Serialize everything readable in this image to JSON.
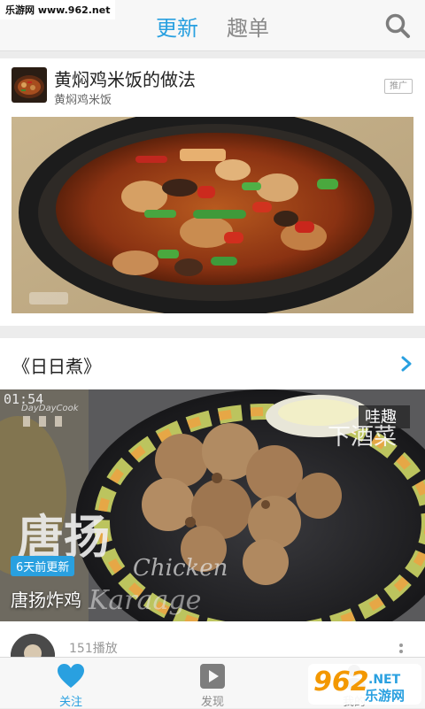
{
  "watermark": "乐游网 www.962.net",
  "header": {
    "tabs": [
      {
        "label": "更新",
        "active": true
      },
      {
        "label": "趣单",
        "active": false
      }
    ]
  },
  "ad_card": {
    "title": "黄焖鸡米饭的做法",
    "subtitle": "黄焖鸡米饭",
    "badge": "推广"
  },
  "section": {
    "title": "《日日煮》",
    "video": {
      "duration": "01:54",
      "update_badge": "6天前更新",
      "title": "唐扬炸鸡",
      "overlay_text_main": "唐扬",
      "overlay_text_en": "Chicken Karaage",
      "channel_mark": "DayDayCook",
      "side_caption": "哇趣 下酒菜"
    },
    "next_item": {
      "play_count": "151播放"
    }
  },
  "bottom_nav": [
    {
      "label": "关注",
      "icon": "heart-icon",
      "active": true
    },
    {
      "label": "发现",
      "icon": "play-icon",
      "active": false
    },
    {
      "label": "我的",
      "icon": "user-icon",
      "active": false
    }
  ],
  "logo": {
    "number": "962",
    "suffix": ".NET",
    "text": "乐游网"
  },
  "colors": {
    "accent": "#29a0e0",
    "inactive": "#8a8a8a",
    "logo_orange": "#f39800"
  }
}
